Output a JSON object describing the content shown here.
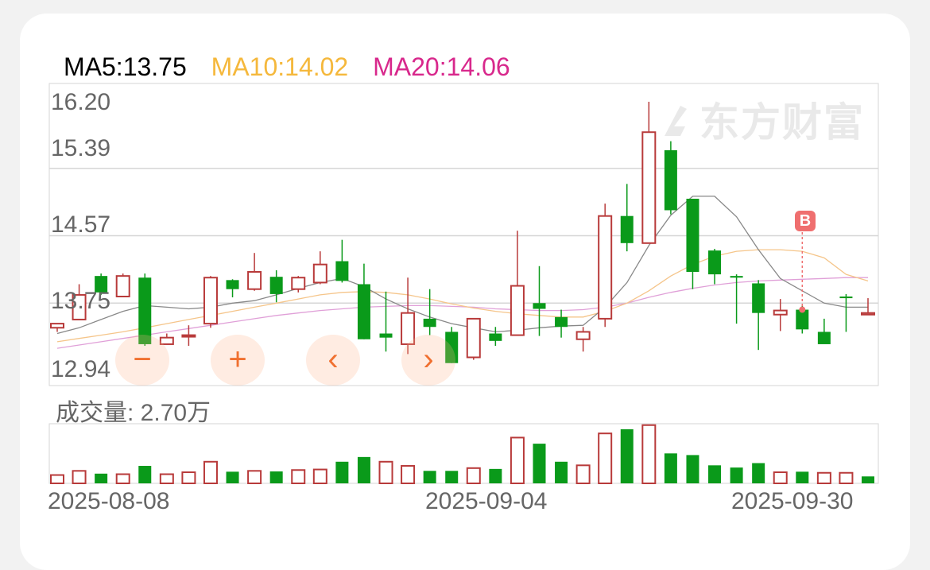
{
  "ma": {
    "ma5": {
      "label": "MA5:13.75",
      "color": "#000000"
    },
    "ma10": {
      "label": "MA10:14.02",
      "color": "#f5b83c"
    },
    "ma20": {
      "label": "MA20:14.06",
      "color": "#d8288c"
    }
  },
  "watermark": "东方财富",
  "volume_label": "成交量: 2.70万",
  "buy_marker": "B",
  "controls": {
    "zoom_out": "−",
    "zoom_in": "+",
    "prev": "‹",
    "next": "›"
  },
  "colors": {
    "up": "#b83a3a",
    "down": "#0a9a1a",
    "grid": "#d6d6d6",
    "ma5": "#888888",
    "ma10": "#f5c58a",
    "ma20": "#e0a0d8"
  },
  "chart_data": {
    "type": "candlestick",
    "y_ticks": [
      "16.20",
      "15.39",
      "14.57",
      "13.75",
      "12.94"
    ],
    "ylim": [
      12.94,
      16.2
    ],
    "x_ticks": [
      "2025-08-08",
      "2025-09-04",
      "2025-09-30"
    ],
    "candles": [
      {
        "o": 13.45,
        "h": 13.5,
        "l": 13.4,
        "c": 13.5
      },
      {
        "o": 13.55,
        "h": 13.98,
        "l": 13.55,
        "c": 13.85
      },
      {
        "o": 14.08,
        "h": 14.11,
        "l": 13.85,
        "c": 13.88
      },
      {
        "o": 13.83,
        "h": 14.11,
        "l": 13.83,
        "c": 14.08
      },
      {
        "o": 14.06,
        "h": 14.11,
        "l": 13.23,
        "c": 13.25
      },
      {
        "o": 13.25,
        "h": 13.38,
        "l": 13.25,
        "c": 13.33
      },
      {
        "o": 13.36,
        "h": 13.48,
        "l": 13.23,
        "c": 13.36
      },
      {
        "o": 13.5,
        "h": 14.08,
        "l": 13.45,
        "c": 14.06
      },
      {
        "o": 14.03,
        "h": 14.04,
        "l": 13.82,
        "c": 13.92
      },
      {
        "o": 13.92,
        "h": 14.36,
        "l": 13.9,
        "c": 14.13
      },
      {
        "o": 14.07,
        "h": 14.15,
        "l": 13.76,
        "c": 13.86
      },
      {
        "o": 13.92,
        "h": 14.08,
        "l": 13.88,
        "c": 14.06
      },
      {
        "o": 14.0,
        "h": 14.38,
        "l": 13.98,
        "c": 14.22
      },
      {
        "o": 14.26,
        "h": 14.52,
        "l": 14.0,
        "c": 14.02
      },
      {
        "o": 13.98,
        "h": 14.23,
        "l": 13.31,
        "c": 13.31
      },
      {
        "o": 13.38,
        "h": 13.89,
        "l": 13.16,
        "c": 13.33
      },
      {
        "o": 13.25,
        "h": 14.06,
        "l": 13.13,
        "c": 13.63
      },
      {
        "o": 13.56,
        "h": 13.92,
        "l": 13.36,
        "c": 13.46
      },
      {
        "o": 13.4,
        "h": 13.46,
        "l": 13.02,
        "c": 13.02
      },
      {
        "o": 13.09,
        "h": 13.56,
        "l": 13.06,
        "c": 13.56
      },
      {
        "o": 13.38,
        "h": 13.46,
        "l": 13.23,
        "c": 13.29
      },
      {
        "o": 13.36,
        "h": 14.63,
        "l": 13.36,
        "c": 13.96
      },
      {
        "o": 13.75,
        "h": 14.2,
        "l": 13.35,
        "c": 13.68
      },
      {
        "o": 13.58,
        "h": 13.67,
        "l": 13.33,
        "c": 13.46
      },
      {
        "o": 13.31,
        "h": 13.46,
        "l": 13.16,
        "c": 13.4
      },
      {
        "o": 13.56,
        "h": 14.96,
        "l": 13.46,
        "c": 14.81
      },
      {
        "o": 14.81,
        "h": 15.2,
        "l": 14.38,
        "c": 14.48
      },
      {
        "o": 14.48,
        "h": 16.2,
        "l": 14.48,
        "c": 15.83
      },
      {
        "o": 15.61,
        "h": 15.72,
        "l": 14.83,
        "c": 14.88
      },
      {
        "o": 15.02,
        "h": 15.02,
        "l": 13.92,
        "c": 14.13
      },
      {
        "o": 14.39,
        "h": 14.41,
        "l": 13.98,
        "c": 14.1
      },
      {
        "o": 14.08,
        "h": 14.1,
        "l": 13.5,
        "c": 14.06
      },
      {
        "o": 13.99,
        "h": 14.03,
        "l": 13.18,
        "c": 13.63
      },
      {
        "o": 13.61,
        "h": 13.8,
        "l": 13.41,
        "c": 13.66
      },
      {
        "o": 13.67,
        "h": 13.73,
        "l": 13.38,
        "c": 13.43
      },
      {
        "o": 13.4,
        "h": 13.56,
        "l": 13.3,
        "c": 13.25
      },
      {
        "o": 13.83,
        "h": 13.86,
        "l": 13.4,
        "c": 13.81
      },
      {
        "o": 13.61,
        "h": 13.81,
        "l": 13.61,
        "c": 13.63
      }
    ],
    "volume": [
      {
        "v": 0.3,
        "up": true
      },
      {
        "v": 0.45,
        "up": true
      },
      {
        "v": 0.35,
        "up": false
      },
      {
        "v": 0.33,
        "up": true
      },
      {
        "v": 0.63,
        "up": false
      },
      {
        "v": 0.33,
        "up": true
      },
      {
        "v": 0.4,
        "up": true
      },
      {
        "v": 0.78,
        "up": true
      },
      {
        "v": 0.42,
        "up": false
      },
      {
        "v": 0.45,
        "up": true
      },
      {
        "v": 0.43,
        "up": false
      },
      {
        "v": 0.48,
        "up": true
      },
      {
        "v": 0.5,
        "up": true
      },
      {
        "v": 0.78,
        "up": false
      },
      {
        "v": 0.95,
        "up": false
      },
      {
        "v": 0.78,
        "up": true
      },
      {
        "v": 0.63,
        "up": true
      },
      {
        "v": 0.45,
        "up": false
      },
      {
        "v": 0.45,
        "up": false
      },
      {
        "v": 0.55,
        "up": true
      },
      {
        "v": 0.52,
        "up": false
      },
      {
        "v": 1.65,
        "up": true
      },
      {
        "v": 1.43,
        "up": false
      },
      {
        "v": 0.78,
        "up": false
      },
      {
        "v": 0.65,
        "up": true
      },
      {
        "v": 1.8,
        "up": true
      },
      {
        "v": 1.95,
        "up": false
      },
      {
        "v": 2.1,
        "up": true
      },
      {
        "v": 1.08,
        "up": false
      },
      {
        "v": 1.02,
        "up": false
      },
      {
        "v": 0.65,
        "up": false
      },
      {
        "v": 0.57,
        "up": false
      },
      {
        "v": 0.73,
        "up": false
      },
      {
        "v": 0.4,
        "up": true
      },
      {
        "v": 0.42,
        "up": false
      },
      {
        "v": 0.38,
        "up": true
      },
      {
        "v": 0.38,
        "up": true
      },
      {
        "v": 0.25,
        "up": false
      }
    ],
    "ma5_series": [
      13.38,
      13.45,
      13.55,
      13.65,
      13.72,
      13.7,
      13.68,
      13.7,
      13.75,
      13.78,
      13.85,
      13.93,
      14.0,
      14.05,
      13.95,
      13.8,
      13.68,
      13.58,
      13.5,
      13.45,
      13.4,
      13.42,
      13.45,
      13.47,
      13.48,
      13.7,
      14.0,
      14.45,
      14.82,
      15.05,
      15.05,
      14.8,
      14.4,
      14.05,
      13.9,
      13.75,
      13.7,
      13.7
    ],
    "ma10_series": [
      13.28,
      13.32,
      13.36,
      13.4,
      13.45,
      13.5,
      13.55,
      13.6,
      13.65,
      13.7,
      13.75,
      13.8,
      13.85,
      13.88,
      13.89,
      13.88,
      13.85,
      13.8,
      13.74,
      13.69,
      13.65,
      13.62,
      13.6,
      13.58,
      13.58,
      13.65,
      13.75,
      13.9,
      14.08,
      14.22,
      14.32,
      14.38,
      14.4,
      14.4,
      14.38,
      14.3,
      14.1,
      14.02
    ],
    "ma20_series": [
      13.2,
      13.24,
      13.28,
      13.32,
      13.36,
      13.4,
      13.44,
      13.48,
      13.52,
      13.56,
      13.6,
      13.63,
      13.66,
      13.68,
      13.7,
      13.71,
      13.72,
      13.72,
      13.71,
      13.7,
      13.68,
      13.67,
      13.66,
      13.66,
      13.67,
      13.7,
      13.75,
      13.82,
      13.88,
      13.93,
      13.97,
      14.0,
      14.02,
      14.03,
      14.04,
      14.05,
      14.06,
      14.06
    ]
  }
}
